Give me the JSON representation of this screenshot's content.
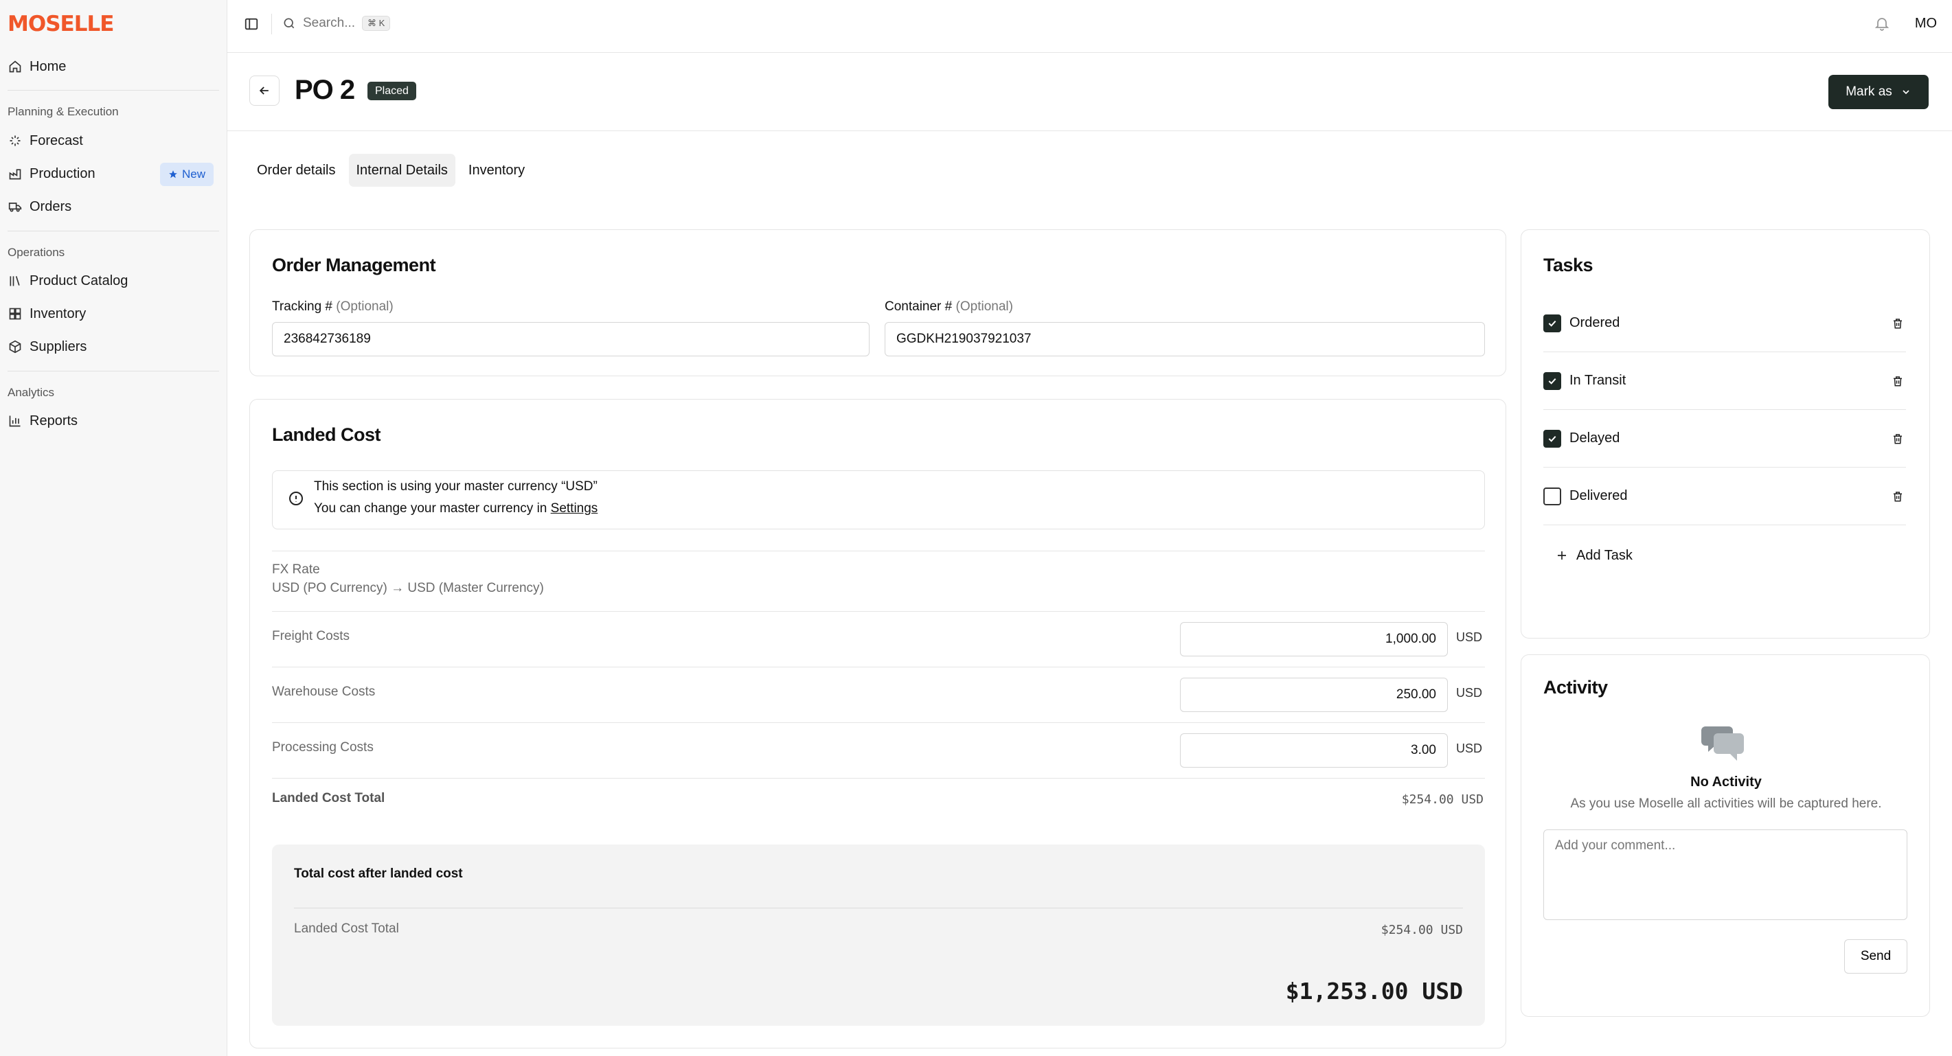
{
  "app": {
    "logo": "MOSELLE"
  },
  "sidebar": {
    "home": "Home",
    "sections": [
      {
        "title": "Planning & Execution",
        "items": [
          "Forecast",
          "Production",
          "Orders"
        ]
      },
      {
        "title": "Operations",
        "items": [
          "Product Catalog",
          "Inventory",
          "Suppliers"
        ]
      },
      {
        "title": "Analytics",
        "items": [
          "Reports"
        ]
      }
    ],
    "production_badge": "New"
  },
  "topbar": {
    "search_placeholder": "Search...",
    "search_shortcut": "⌘ K",
    "avatar": "MO"
  },
  "header": {
    "title": "PO 2",
    "status": "Placed",
    "mark_as": "Mark as"
  },
  "tabs": [
    "Order details",
    "Internal Details",
    "Inventory"
  ],
  "order_management": {
    "title": "Order Management",
    "tracking_label": "Tracking #",
    "container_label": "Container #",
    "optional": "(Optional)",
    "tracking_value": "236842736189",
    "container_value": "GGDKH219037921037"
  },
  "landed_cost": {
    "title": "Landed Cost",
    "notice_line1": "This section is using your master currency “USD”",
    "notice_line2": "You can change your master currency in",
    "notice_link": "Settings",
    "fx_label": "FX Rate",
    "fx_value": "USD (PO Currency) → USD (Master Currency)",
    "rows": [
      {
        "label": "Freight Costs",
        "value": "1,000.00",
        "unit": "USD"
      },
      {
        "label": "Warehouse Costs",
        "value": "250.00",
        "unit": "USD"
      },
      {
        "label": "Processing Costs",
        "value": "3.00",
        "unit": "USD"
      }
    ],
    "total_label": "Landed Cost Total",
    "total_value": "$254.00 USD",
    "summary_title": "Total cost after landed cost",
    "summary_label": "Landed Cost Total",
    "summary_value": "$254.00 USD",
    "grand_total": "$1,253.00 USD"
  },
  "tasks": {
    "title": "Tasks",
    "items": [
      {
        "label": "Ordered",
        "checked": true
      },
      {
        "label": "In Transit",
        "checked": true
      },
      {
        "label": "Delayed",
        "checked": true
      },
      {
        "label": "Delivered",
        "checked": false
      }
    ],
    "add_label": "Add Task"
  },
  "activity": {
    "title": "Activity",
    "empty_title": "No Activity",
    "empty_sub": "As you use Moselle all activities will be captured here.",
    "comment_placeholder": "Add your comment...",
    "send": "Send"
  },
  "colors": {
    "brand": "#f0572a",
    "primary_dark": "#1f2a26",
    "badge_blue_bg": "#dbe7fa",
    "badge_blue_text": "#1e5fd0"
  }
}
